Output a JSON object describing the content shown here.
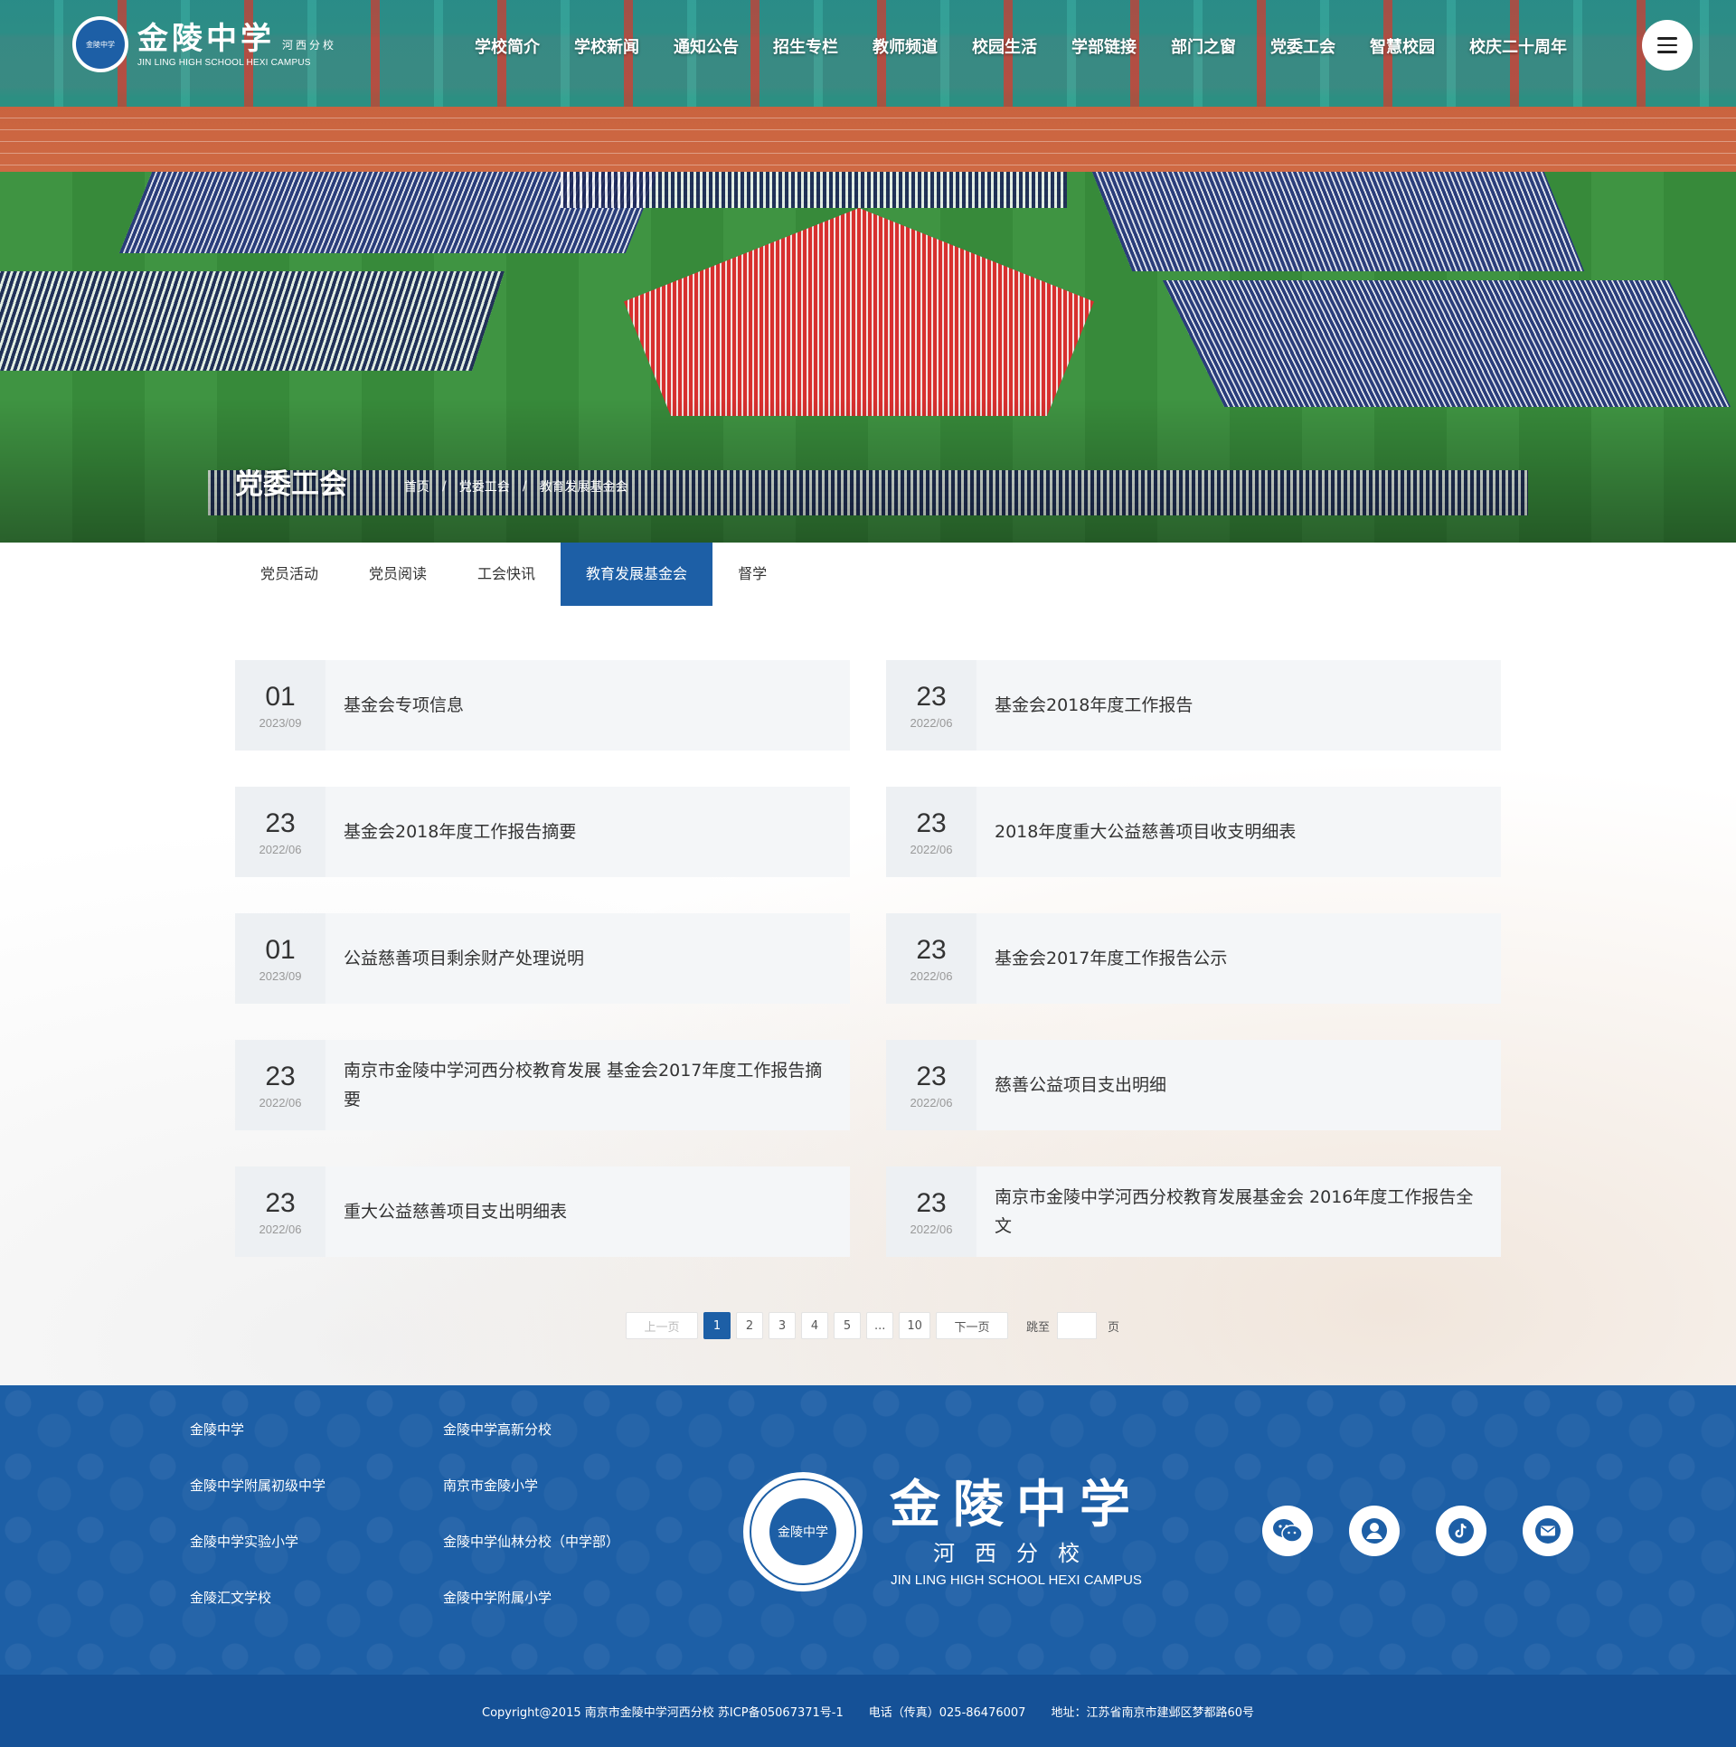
{
  "header": {
    "logo": {
      "cn": "金陵中学",
      "sub": "河西分校",
      "en": "JIN LING HIGH SCHOOL HEXI CAMPUS",
      "seal": "金陵中学"
    },
    "nav": [
      "学校简介",
      "学校新闻",
      "通知公告",
      "招生专栏",
      "教师频道",
      "校园生活",
      "学部链接",
      "部门之窗",
      "党委工会",
      "智慧校园",
      "校庆二十周年"
    ],
    "menu_icon": "hamburger-icon"
  },
  "banner": {
    "title": "党委工会",
    "breadcrumb": [
      "首页",
      "党委工会",
      "教育发展基金会"
    ],
    "separator": "/"
  },
  "subnav": {
    "tabs": [
      "党员活动",
      "党员阅读",
      "工会快讯",
      "教育发展基金会",
      "督学"
    ],
    "active": "教育发展基金会"
  },
  "articles": [
    {
      "day": "01",
      "ym": "2023/09",
      "title": "基金会专项信息"
    },
    {
      "day": "23",
      "ym": "2022/06",
      "title": "基金会2018年度工作报告"
    },
    {
      "day": "23",
      "ym": "2022/06",
      "title": "基金会2018年度工作报告摘要"
    },
    {
      "day": "23",
      "ym": "2022/06",
      "title": "2018年度重大公益慈善项目收支明细表"
    },
    {
      "day": "01",
      "ym": "2023/09",
      "title": "公益慈善项目剩余财产处理说明"
    },
    {
      "day": "23",
      "ym": "2022/06",
      "title": "基金会2017年度工作报告公示"
    },
    {
      "day": "23",
      "ym": "2022/06",
      "title": "南京市金陵中学河西分校教育发展 基金会2017年度工作报告摘要"
    },
    {
      "day": "23",
      "ym": "2022/06",
      "title": "慈善公益项目支出明细"
    },
    {
      "day": "23",
      "ym": "2022/06",
      "title": "重大公益慈善项目支出明细表"
    },
    {
      "day": "23",
      "ym": "2022/06",
      "title": "南京市金陵中学河西分校教育发展基金会 2016年度工作报告全文"
    }
  ],
  "pager": {
    "prev": "上一页",
    "pages": [
      "1",
      "2",
      "3",
      "4",
      "5",
      "...",
      "10"
    ],
    "current": "1",
    "next": "下一页",
    "jump_label": "跳至",
    "jump_unit": "页"
  },
  "footer": {
    "links": [
      "金陵中学",
      "金陵中学高新分校",
      "金陵中学附属初级中学",
      "南京市金陵小学",
      "金陵中学实验小学",
      "金陵中学仙林分校（中学部）",
      "金陵汇文学校",
      "金陵中学附属小学"
    ],
    "logo": {
      "cn": "金陵中学",
      "sub": "河西分校",
      "en": "JIN LING HIGH SCHOOL HEXI CAMPUS",
      "seal": "金陵中学"
    },
    "socials": [
      "wechat-icon",
      "user-icon",
      "tiktok-icon",
      "mail-icon"
    ],
    "copyright": "Copyright@2015 南京市金陵中学河西分校  苏ICP备05067371号-1",
    "phone": "电话（传真）025-86476007",
    "address": "地址：江苏省南京市建邺区梦都路60号"
  },
  "colors": {
    "brand": "#1d5fa6",
    "footer_bottom": "#155197",
    "card_bg": "#f4f6f8"
  }
}
